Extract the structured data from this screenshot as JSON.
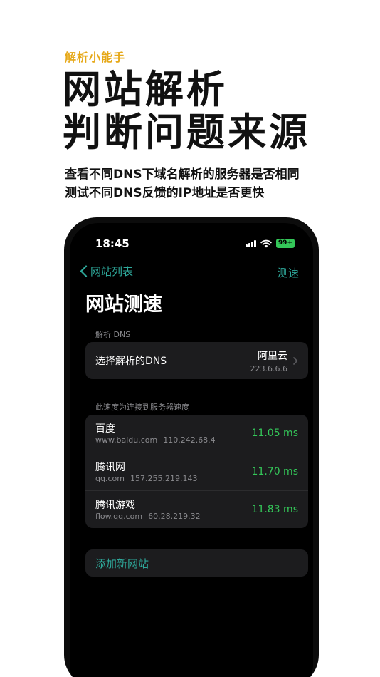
{
  "promo": {
    "kicker": "解析小能手",
    "title_line1": "网站解析",
    "title_line2": "判断问题来源",
    "sub_line1": "查看不同DNS下域名解析的服务器是否相同",
    "sub_line2": "测试不同DNS反馈的IP地址是否更快"
  },
  "status": {
    "time": "18:45",
    "battery": "99+"
  },
  "nav": {
    "back_label": "网站列表",
    "action_label": "测速"
  },
  "page": {
    "title": "网站测速"
  },
  "dns": {
    "section_label": "解析 DNS",
    "row_label": "选择解析的DNS",
    "selected_name": "阿里云",
    "selected_ip": "223.6.6.6"
  },
  "speed": {
    "section_label": "此速度为连接到服务器速度",
    "sites": [
      {
        "name": "百度",
        "domain": "www.baidu.com",
        "ip": "110.242.68.4",
        "speed": "11.05 ms"
      },
      {
        "name": "腾讯网",
        "domain": "qq.com",
        "ip": "157.255.219.143",
        "speed": "11.70 ms"
      },
      {
        "name": "腾讯游戏",
        "domain": "flow.qq.com",
        "ip": "60.28.219.32",
        "speed": "11.83 ms"
      }
    ]
  },
  "add_site": {
    "label": "添加新网站"
  },
  "colors": {
    "accent": "#2ea89a",
    "kicker": "#e6a817",
    "speed": "#34c759",
    "card": "#1c1c1e"
  }
}
